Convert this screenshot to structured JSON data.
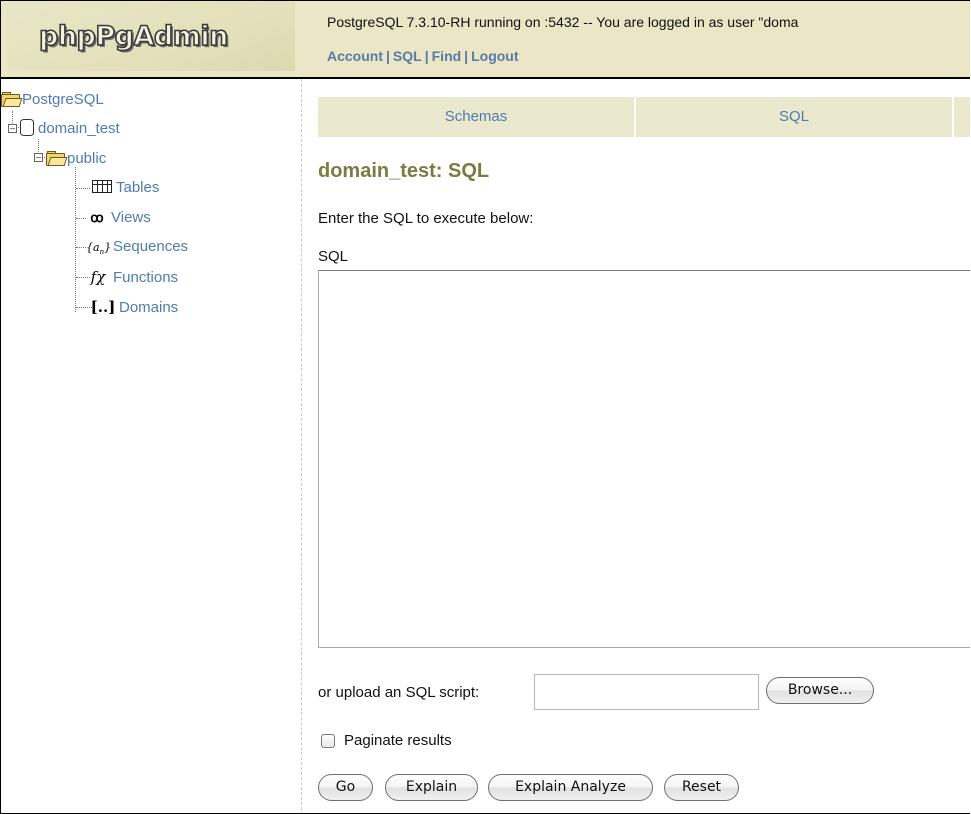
{
  "header": {
    "logo_text": "phpPgAdmin",
    "server_info": "PostgreSQL 7.3.10-RH running on :5432 -- You are logged in as user \"doma",
    "links": [
      "Account",
      "SQL",
      "Find",
      "Logout"
    ],
    "separator": "|"
  },
  "tree": {
    "server": "PostgreSQL",
    "database": "domain_test",
    "schema": "public",
    "items": [
      {
        "label": "Tables",
        "icon": "table-icon"
      },
      {
        "label": "Views",
        "icon": "views-icon"
      },
      {
        "label": "Sequences",
        "icon": "sequences-icon"
      },
      {
        "label": "Functions",
        "icon": "functions-icon"
      },
      {
        "label": "Domains",
        "icon": "domains-icon"
      }
    ]
  },
  "tabs": [
    "Schemas",
    "SQL"
  ],
  "main": {
    "title": "domain_test: SQL",
    "prompt": "Enter the SQL to execute below:",
    "sql_label": "SQL",
    "sql_value": "",
    "upload_label": "or upload an SQL script:",
    "browse_label": "Browse...",
    "paginate_label": "Paginate results",
    "paginate_checked": false,
    "buttons": [
      "Go",
      "Explain",
      "Explain Analyze",
      "Reset"
    ]
  },
  "colors": {
    "link": "#4f7bb3",
    "header_bg": "#eae6c6",
    "tab_bg": "#ebe9cd",
    "title": "#7b7b45"
  }
}
